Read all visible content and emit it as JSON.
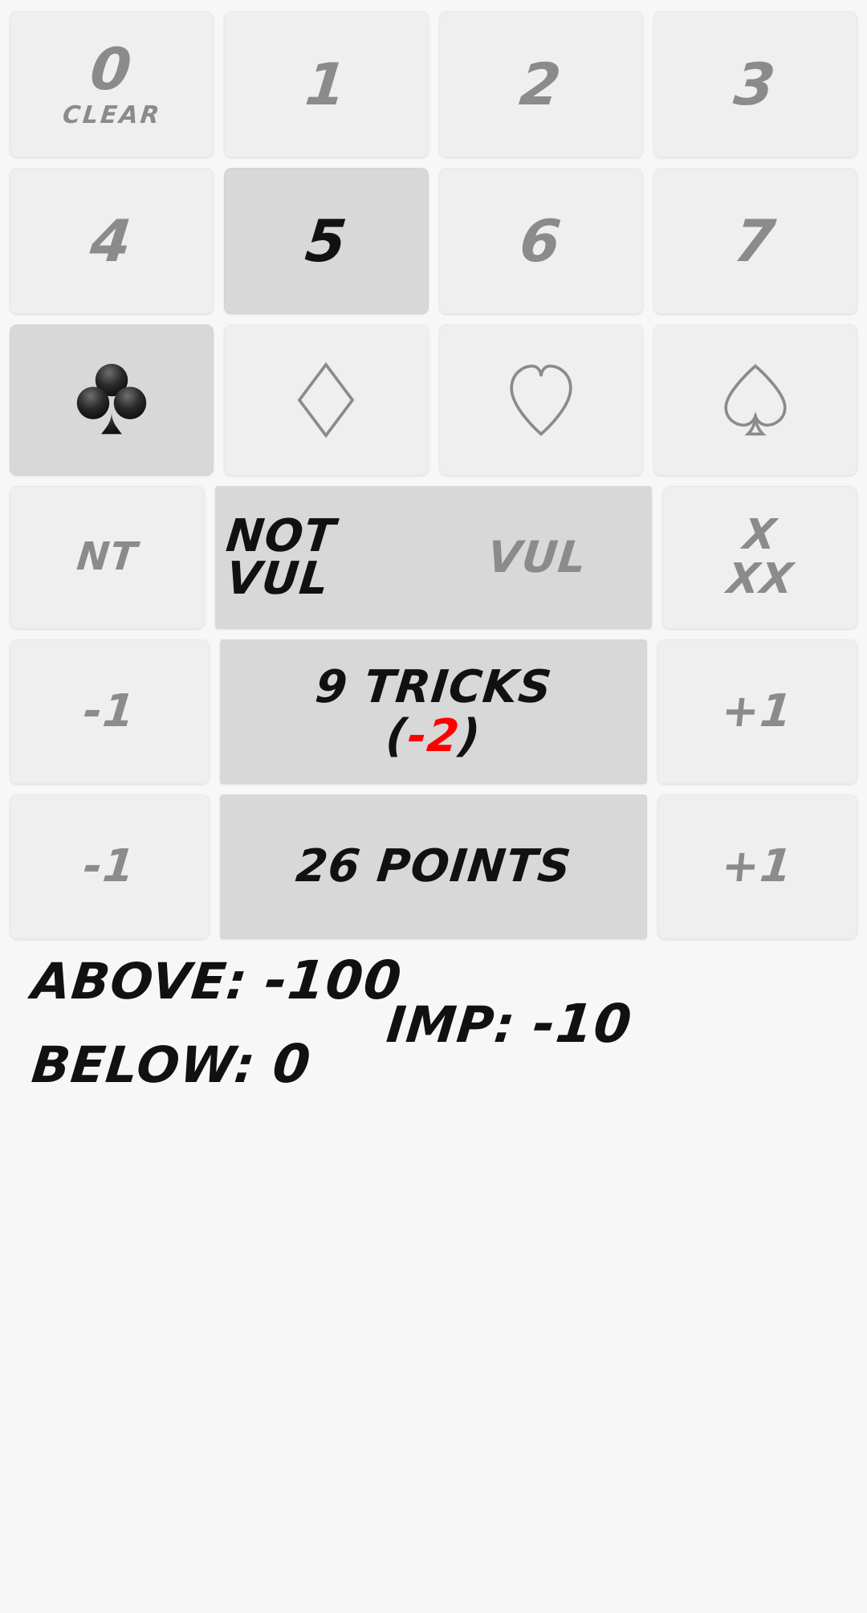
{
  "app": {
    "name": "bridge-score-calculator"
  },
  "colors": {
    "background": "#f7f7f7",
    "button": "#efefef",
    "button_selected": "#d8d8d8",
    "text_inactive": "#8b8b8b",
    "text_active": "#111111",
    "negative": "#ff0000"
  },
  "level_row_1": {
    "buttons": [
      {
        "label": "0",
        "sublabel": "CLEAR",
        "selected": false,
        "name": "level-0-clear"
      },
      {
        "label": "1",
        "sublabel": "",
        "selected": false,
        "name": "level-1"
      },
      {
        "label": "2",
        "sublabel": "",
        "selected": false,
        "name": "level-2"
      },
      {
        "label": "3",
        "sublabel": "",
        "selected": false,
        "name": "level-3"
      }
    ]
  },
  "level_row_2": {
    "buttons": [
      {
        "label": "4",
        "selected": false,
        "name": "level-4"
      },
      {
        "label": "5",
        "selected": true,
        "name": "level-5"
      },
      {
        "label": "6",
        "selected": false,
        "name": "level-6"
      },
      {
        "label": "7",
        "selected": false,
        "name": "level-7"
      }
    ]
  },
  "suit_row": {
    "buttons": [
      {
        "icon": "club-icon",
        "suit": "clubs",
        "selected": true,
        "name": "suit-clubs"
      },
      {
        "icon": "diamond-icon",
        "suit": "diamonds",
        "selected": false,
        "name": "suit-diamonds"
      },
      {
        "icon": "heart-icon",
        "suit": "hearts",
        "selected": false,
        "name": "suit-hearts"
      },
      {
        "icon": "spade-icon",
        "suit": "spades",
        "selected": false,
        "name": "suit-spades"
      }
    ]
  },
  "vulnerability_row": {
    "nt_label": "NT",
    "nt_selected": false,
    "not_vul_label_line1": "NOT",
    "not_vul_label_line2": "VUL",
    "not_vul_selected": true,
    "vul_label": "VUL",
    "vul_selected": false,
    "double_label_line1": "X",
    "double_label_line2": "XX",
    "double_selected": false
  },
  "tricks_row": {
    "decrement_label": "-1",
    "increment_label": "+1",
    "main_line1": "9 TRICKS",
    "main_line2_open": "(",
    "main_line2_value": "-2",
    "main_line2_close": ")",
    "tricks_count": 9,
    "result_delta": -2
  },
  "points_row": {
    "decrement_label": "-1",
    "increment_label": "+1",
    "main_label": "26 POINTS",
    "points": 26
  },
  "summary": {
    "above_label": "ABOVE:",
    "above_value": "-100",
    "below_label": "BELOW:",
    "below_value": "0",
    "imp_label": "IMP:",
    "imp_value": "-10"
  }
}
